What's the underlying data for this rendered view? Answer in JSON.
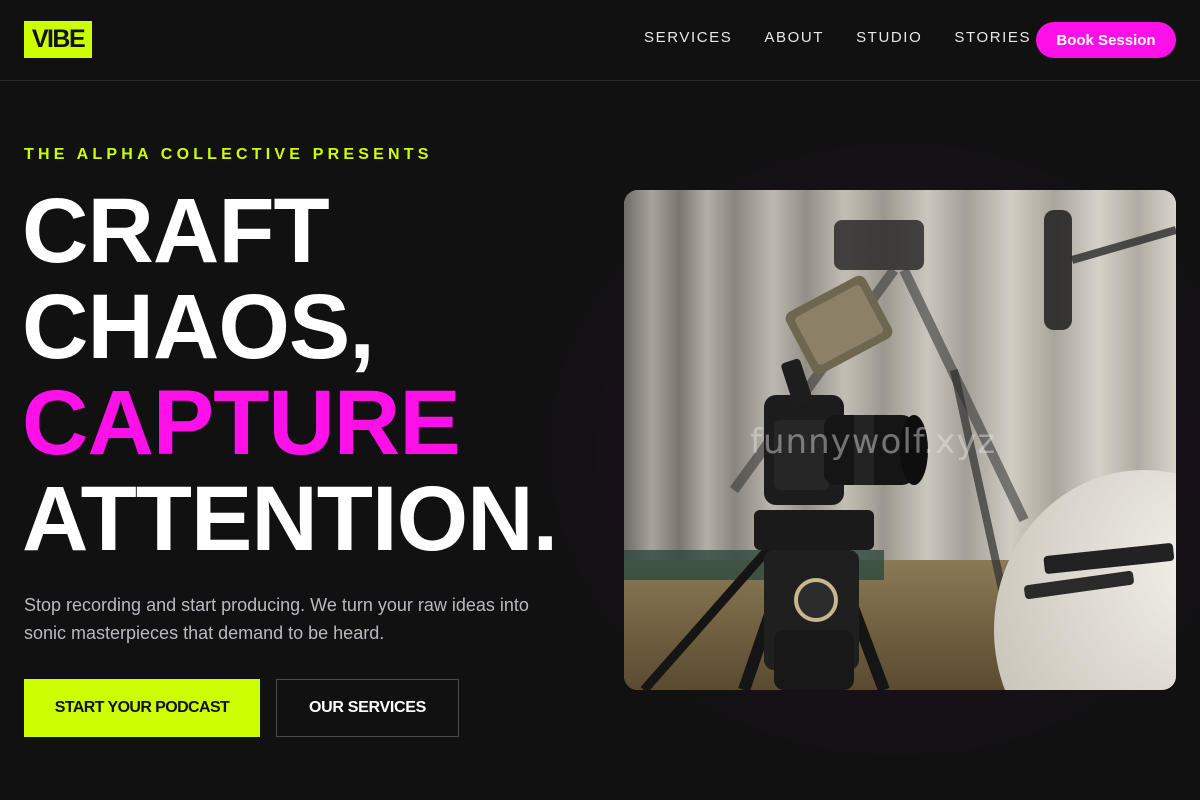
{
  "brand": {
    "logo": "VIBE"
  },
  "nav": {
    "items": [
      "SERVICES",
      "ABOUT",
      "STUDIO",
      "STORIES"
    ],
    "cta": "Book Session"
  },
  "hero": {
    "eyebrow": "THE ALPHA COLLECTIVE PRESENTS",
    "headline": [
      "CRAFT",
      "CHAOS,",
      "CAPTURE",
      "ATTENTION."
    ],
    "subtext": "Stop recording and start producing. We turn your raw ideas into sonic masterpieces that demand to be heard.",
    "primary_button": "START YOUR PODCAST",
    "secondary_button": "OUR SERVICES",
    "image_watermark": "funnywolf.xyz"
  },
  "colors": {
    "accent_lime": "#ccff00",
    "accent_magenta": "#ff10e8",
    "background": "#111111"
  }
}
